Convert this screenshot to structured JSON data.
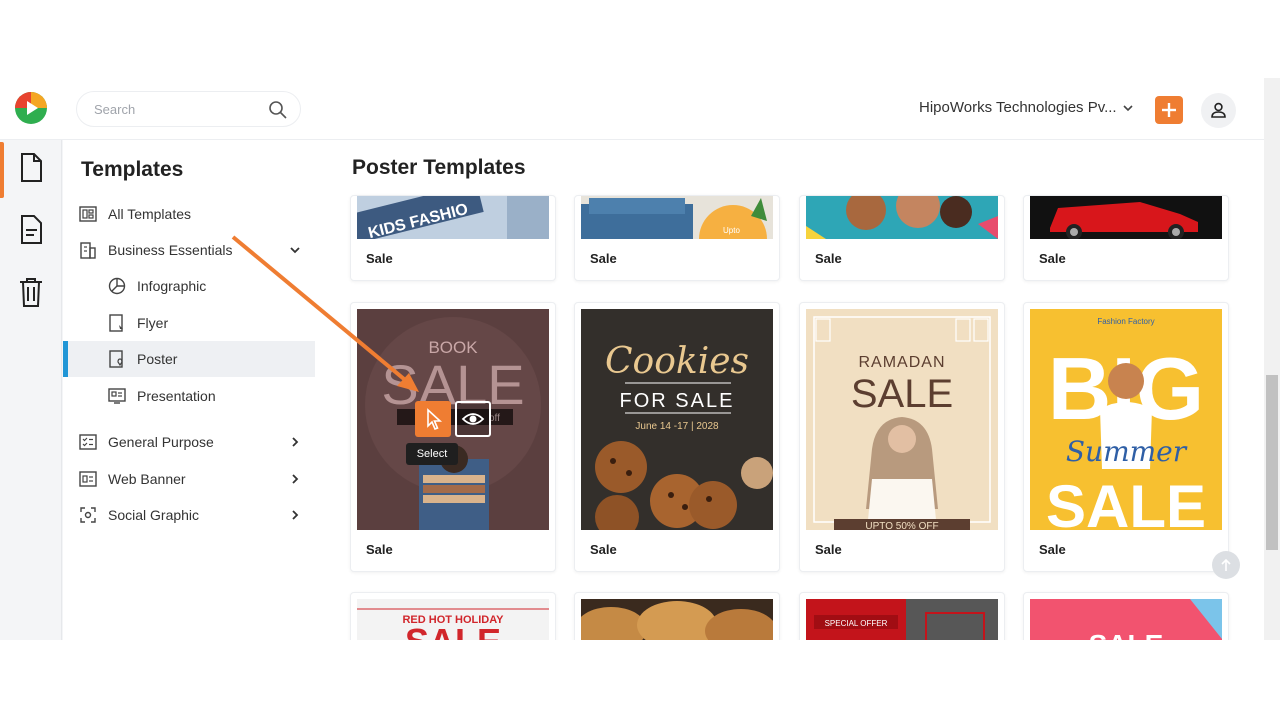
{
  "search": {
    "placeholder": "Search"
  },
  "header": {
    "org_name": "HipoWorks Technologies Pv..."
  },
  "sidebar": {
    "title": "Templates",
    "items": [
      {
        "label": "All Templates"
      },
      {
        "label": "Business Essentials"
      },
      {
        "label": "Infographic"
      },
      {
        "label": "Flyer"
      },
      {
        "label": "Poster"
      },
      {
        "label": "Presentation"
      },
      {
        "label": "General Purpose"
      },
      {
        "label": "Web Banner"
      },
      {
        "label": "Social Graphic"
      }
    ]
  },
  "main": {
    "title": "Poster Templates",
    "captions": [
      "Sale",
      "Sale",
      "Sale",
      "Sale",
      "Sale",
      "Sale",
      "Sale",
      "Sale"
    ],
    "hover": {
      "select_tooltip": "Select"
    },
    "posters": {
      "kids": "KIDS FASHIO",
      "upto": "Upto",
      "book_top": "BOOK",
      "book_big": "SALE",
      "book_off": "off",
      "cookies": "Cookies",
      "for_sale": "FOR SALE",
      "cookie_date": "June 14 -17 | 2028",
      "ramadan": "RAMADAN",
      "ramadan_sale": "SALE",
      "upto_off": "UPTO 50% OFF",
      "fashion_factory": "Fashion Factory",
      "big": "BIG",
      "summer": "Summer",
      "summer_sale": "SALE",
      "red_hot": "RED HOT HOLIDAY",
      "red_sale": "SALE",
      "special_offer": "SPECIAL OFFER",
      "pink_sale": "SALE"
    }
  },
  "colors": {
    "accent": "#ef7d32",
    "active_bar": "#2196d6"
  }
}
